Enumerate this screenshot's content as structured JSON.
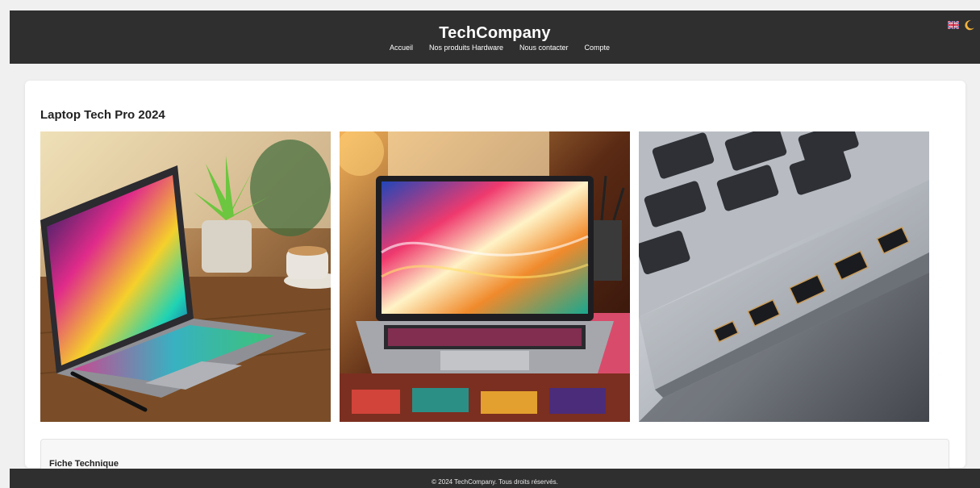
{
  "header": {
    "brand": "TechCompany",
    "nav": [
      "Accueil",
      "Nos produits Hardware",
      "Nous contacter",
      "Compte"
    ],
    "icons": [
      "uk-flag-icon",
      "moon-icon"
    ]
  },
  "product": {
    "title": "Laptop Tech Pro 2024",
    "images": [
      "laptop-desk-photo",
      "laptop-abstract-photo",
      "laptop-ports-photo"
    ]
  },
  "spec": {
    "title": "Fiche Technique"
  },
  "footer": {
    "text": "© 2024 TechCompany. Tous droits réservés."
  }
}
